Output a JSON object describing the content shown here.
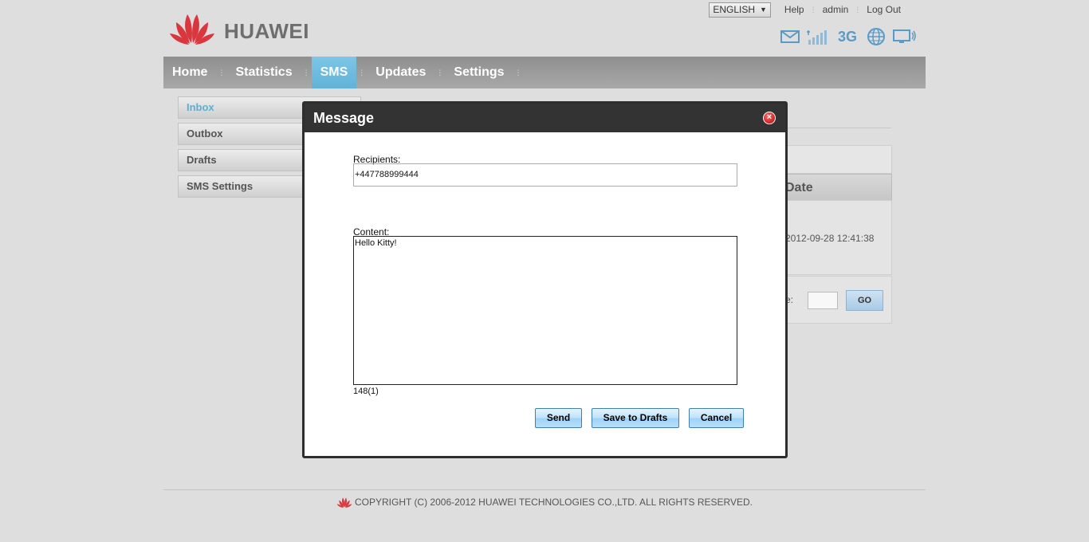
{
  "brand": {
    "name": "HUAWEI"
  },
  "toplinks": {
    "language": "ENGLISH",
    "help": "Help",
    "user": "admin",
    "logout": "Log Out"
  },
  "status": {
    "network": "3G",
    "icons": [
      "mail-icon",
      "signal-icon",
      "3g-indicator",
      "internet-icon",
      "device-icon"
    ]
  },
  "nav": {
    "items": [
      "Home",
      "Statistics",
      "SMS",
      "Updates",
      "Settings"
    ],
    "active": "SMS"
  },
  "sidebar": {
    "items": [
      "Inbox",
      "Outbox",
      "Drafts",
      "SMS Settings"
    ],
    "active": "Inbox"
  },
  "background_table": {
    "date_header": "Date",
    "row_date": "2012-09-28 12:41:38",
    "pager_suffix": "e:",
    "go_label": "GO"
  },
  "modal": {
    "title": "Message",
    "recipients_label": "Recipients:",
    "recipients_value": "+447788999444",
    "content_label": "Content:",
    "content_value": "Hello Kitty!",
    "counter": "148(1)",
    "send_label": "Send",
    "save_label": "Save to Drafts",
    "cancel_label": "Cancel"
  },
  "footer": {
    "copyright": "COPYRIGHT (C) 2006-2012 HUAWEI TECHNOLOGIES CO.,LTD. ALL RIGHTS RESERVED."
  },
  "colors": {
    "accent": "#5fb3d9",
    "nav_bg": "#9a9a9a",
    "brand_red": "#d9363e",
    "modal_header": "#333333"
  }
}
